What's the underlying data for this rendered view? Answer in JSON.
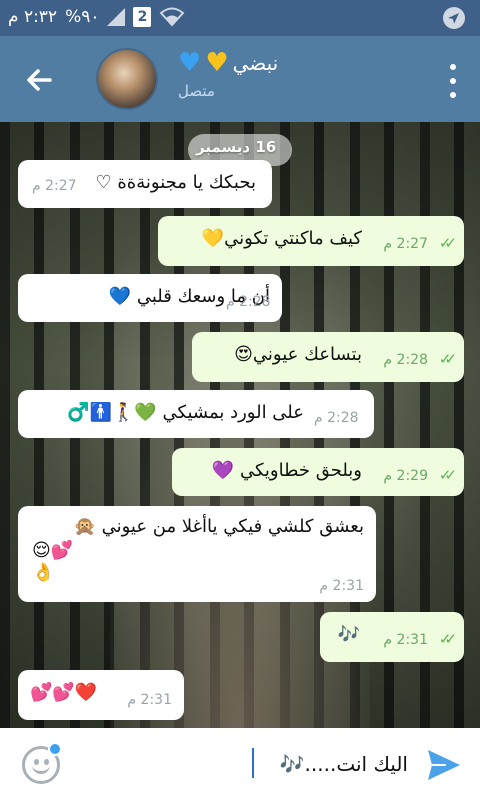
{
  "status_bar": {
    "time": "٢:٣٢ م",
    "battery": "%٩٠",
    "sim": "2"
  },
  "header": {
    "contact_name": "نبضي",
    "status": "متصل"
  },
  "chat": {
    "date_label": "16 ديسمبر",
    "messages": [
      {
        "dir": "in",
        "text": "بحبكك يا مجنونةةة ♡",
        "time": "2:27 م"
      },
      {
        "dir": "out",
        "text": "كيف ماكنتي تكوني💛",
        "time": "2:27 م"
      },
      {
        "dir": "in",
        "text": "أن ما وسعك قلبي 💙",
        "time": "2:28 م"
      },
      {
        "dir": "out",
        "text": "بتساعك عيوني😍",
        "time": "2:28 م"
      },
      {
        "dir": "in",
        "text": "على الورد بمشيكي 💚🚶‍♀️🚹♂️",
        "time": "2:28 م"
      },
      {
        "dir": "out",
        "text": "وبلحق خطاويكي 💜",
        "time": "2:29 م"
      },
      {
        "dir": "in",
        "text_line1": "بعشق كلشي فيكي ياأغلا من عيوني 🙊",
        "text_line2": "😌💕",
        "text_line3": "👌",
        "time": "2:31 م"
      },
      {
        "dir": "out",
        "text": "🎶",
        "time": "2:31 م"
      },
      {
        "dir": "in",
        "text": "💕💕❤️",
        "time": "2:31 م"
      }
    ]
  },
  "input": {
    "value": "اليك انت.....🎶"
  },
  "colors": {
    "header": "#527da3",
    "status_bar": "#3f6089",
    "incoming_bubble": "#ffffff",
    "outgoing_bubble": "#effdde",
    "accent": "#3ba2f2"
  }
}
